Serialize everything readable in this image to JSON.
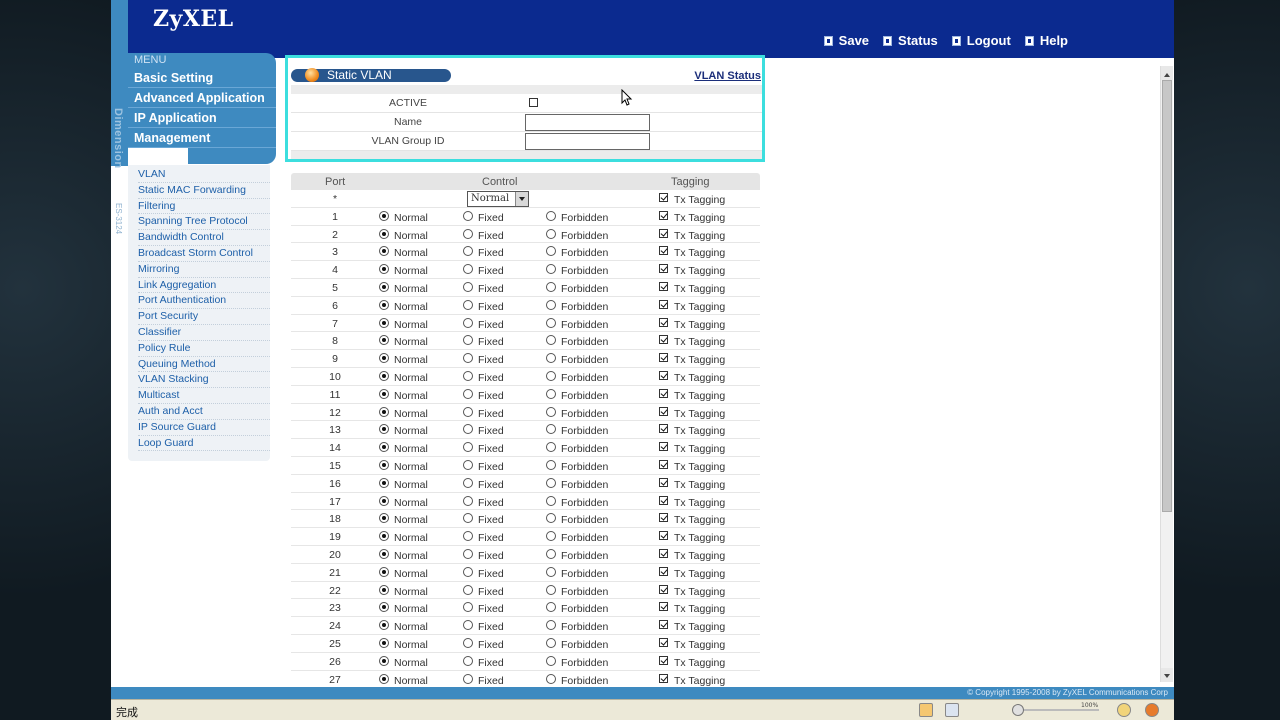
{
  "header": {
    "logo": "ZyXEL",
    "nav": [
      {
        "label": "Save",
        "icon": "save-icon"
      },
      {
        "label": "Status",
        "icon": "status-icon"
      },
      {
        "label": "Logout",
        "icon": "logout-icon"
      },
      {
        "label": "Help",
        "icon": "help-icon"
      }
    ]
  },
  "sidebar": {
    "brand": "Dimension",
    "model": "ES-3124",
    "menu_title": "MENU",
    "main_items": [
      "Basic Setting",
      "Advanced Application",
      "IP Application",
      "Management"
    ],
    "sub_items": [
      "VLAN",
      "Static MAC Forwarding",
      "Filtering",
      "Spanning Tree Protocol",
      "Bandwidth Control",
      "Broadcast Storm Control",
      "Mirroring",
      "Link Aggregation",
      "Port Authentication",
      "Port Security",
      "Classifier",
      "Policy Rule",
      "Queuing Method",
      "VLAN Stacking",
      "Multicast",
      "Auth and Acct",
      "IP Source Guard",
      "Loop Guard"
    ]
  },
  "panel": {
    "title": "Static VLAN",
    "status_link": "VLAN Status",
    "active_label": "ACTIVE",
    "active_checked": false,
    "name_label": "Name",
    "name_value": "",
    "group_label": "VLAN Group ID",
    "group_value": ""
  },
  "port_table": {
    "headers": {
      "port": "Port",
      "control": "Control",
      "tagging": "Tagging"
    },
    "wildcard": {
      "port": "*",
      "control": "Normal",
      "tagging_label": "Tx Tagging",
      "tagging_checked": true
    },
    "control_options": [
      "Normal",
      "Fixed",
      "Forbidden"
    ],
    "tagging_label": "Tx Tagging",
    "rows": [
      {
        "port": "1",
        "control": "Normal",
        "tx": true
      },
      {
        "port": "2",
        "control": "Normal",
        "tx": true
      },
      {
        "port": "3",
        "control": "Normal",
        "tx": true
      },
      {
        "port": "4",
        "control": "Normal",
        "tx": true
      },
      {
        "port": "5",
        "control": "Normal",
        "tx": true
      },
      {
        "port": "6",
        "control": "Normal",
        "tx": true
      },
      {
        "port": "7",
        "control": "Normal",
        "tx": true
      },
      {
        "port": "8",
        "control": "Normal",
        "tx": true
      },
      {
        "port": "9",
        "control": "Normal",
        "tx": true
      },
      {
        "port": "10",
        "control": "Normal",
        "tx": true
      },
      {
        "port": "11",
        "control": "Normal",
        "tx": true
      },
      {
        "port": "12",
        "control": "Normal",
        "tx": true
      },
      {
        "port": "13",
        "control": "Normal",
        "tx": true
      },
      {
        "port": "14",
        "control": "Normal",
        "tx": true
      },
      {
        "port": "15",
        "control": "Normal",
        "tx": true
      },
      {
        "port": "16",
        "control": "Normal",
        "tx": true
      },
      {
        "port": "17",
        "control": "Normal",
        "tx": true
      },
      {
        "port": "18",
        "control": "Normal",
        "tx": true
      },
      {
        "port": "19",
        "control": "Normal",
        "tx": true
      },
      {
        "port": "20",
        "control": "Normal",
        "tx": true
      },
      {
        "port": "21",
        "control": "Normal",
        "tx": true
      },
      {
        "port": "22",
        "control": "Normal",
        "tx": true
      },
      {
        "port": "23",
        "control": "Normal",
        "tx": true
      },
      {
        "port": "24",
        "control": "Normal",
        "tx": true
      },
      {
        "port": "25",
        "control": "Normal",
        "tx": true
      },
      {
        "port": "26",
        "control": "Normal",
        "tx": true
      },
      {
        "port": "27",
        "control": "Normal",
        "tx": true
      }
    ]
  },
  "footer": {
    "copyright": "© Copyright 1995-2008 by ZyXEL Communications Corp",
    "status": "完成",
    "zoom": "100%"
  },
  "colors": {
    "header_bg": "#0b2a8f",
    "menu_bg": "#3e8ac0",
    "highlight": "#3cdede",
    "link": "#1d5fa8"
  }
}
